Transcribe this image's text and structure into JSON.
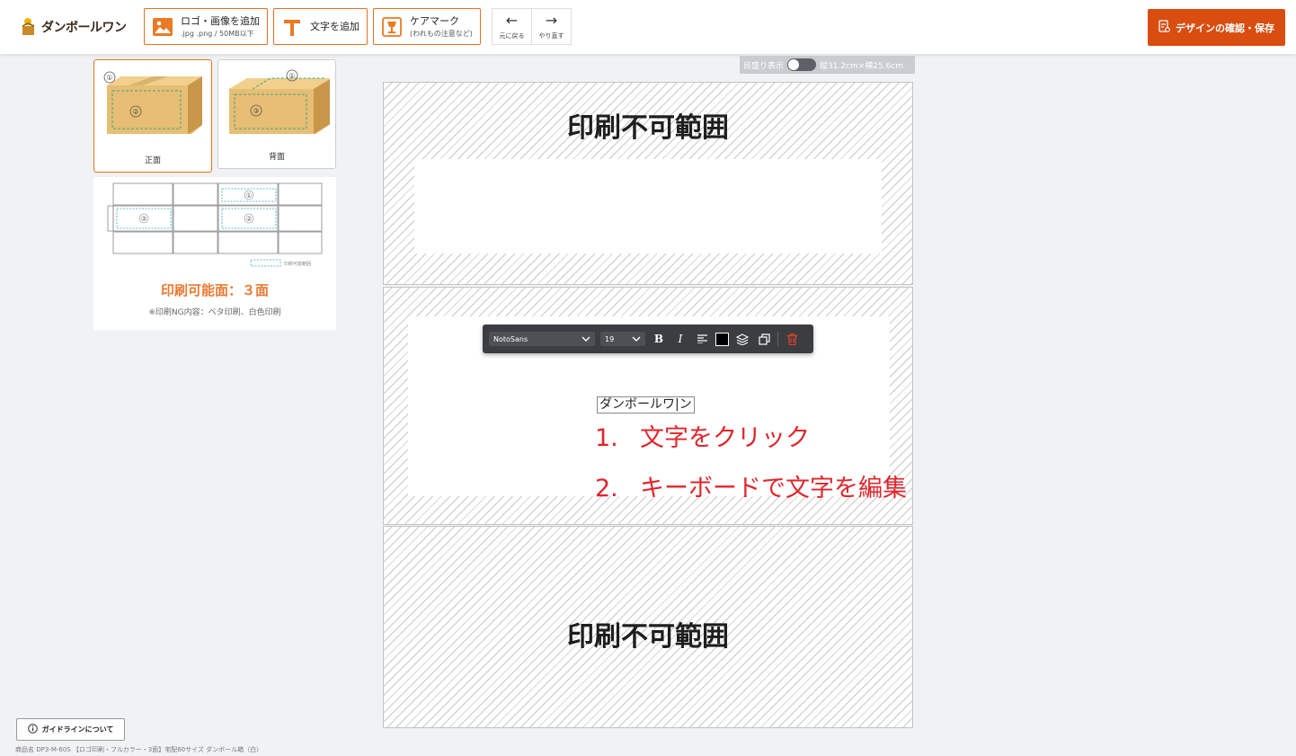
{
  "header": {
    "logo_text": "ダンボールワン",
    "add_image": {
      "label": "ロゴ・画像を追加",
      "sub": ".jpg .png / 50MB以下",
      "icon": "image-icon"
    },
    "add_text": {
      "label": "文字を追加",
      "icon": "text-icon"
    },
    "care_mark": {
      "label": "ケアマーク",
      "sub": "(われもの注意など)",
      "icon": "care-mark-icon"
    },
    "undo_label": "元に戻る",
    "redo_label": "やり直す",
    "confirm_label": "デザインの確認・保存",
    "accent_color": "#e8711e",
    "confirm_color": "#d94d10"
  },
  "faces": [
    {
      "label": "正面",
      "num_top": "①",
      "num_center": "②",
      "active": true
    },
    {
      "label": "背面",
      "num_top": "①",
      "num_center": "③",
      "active": false
    }
  ],
  "diagram": {
    "legend": "印刷可能範囲",
    "printable_title": "印刷可能面：３面",
    "note": "※印刷NG内容：ベタ印刷、白色印刷",
    "labels": [
      "①",
      "②",
      "③"
    ]
  },
  "canvas": {
    "scale_label": "目盛り表示",
    "dimensions": "縦31.2cm×横25.6cm",
    "noprint_top": "印刷不可範囲",
    "noprint_bottom": "印刷不可範囲"
  },
  "text_toolbar": {
    "font": "NotoSans",
    "size": "19",
    "bold": "B",
    "italic": "I",
    "color": "#000000"
  },
  "text_element": "ダンボールワ|ン",
  "instructions": [
    {
      "num": "1.",
      "text": "文字をクリック"
    },
    {
      "num": "2.",
      "text": "キーボードで文字を編集"
    }
  ],
  "footer": {
    "guide_label": "ガイドラインについて",
    "product_name": "商品名 DP3-M-60S 【ロゴ印刷・フルカラー・3面】宅配60サイズ ダンボール箱（白）"
  }
}
